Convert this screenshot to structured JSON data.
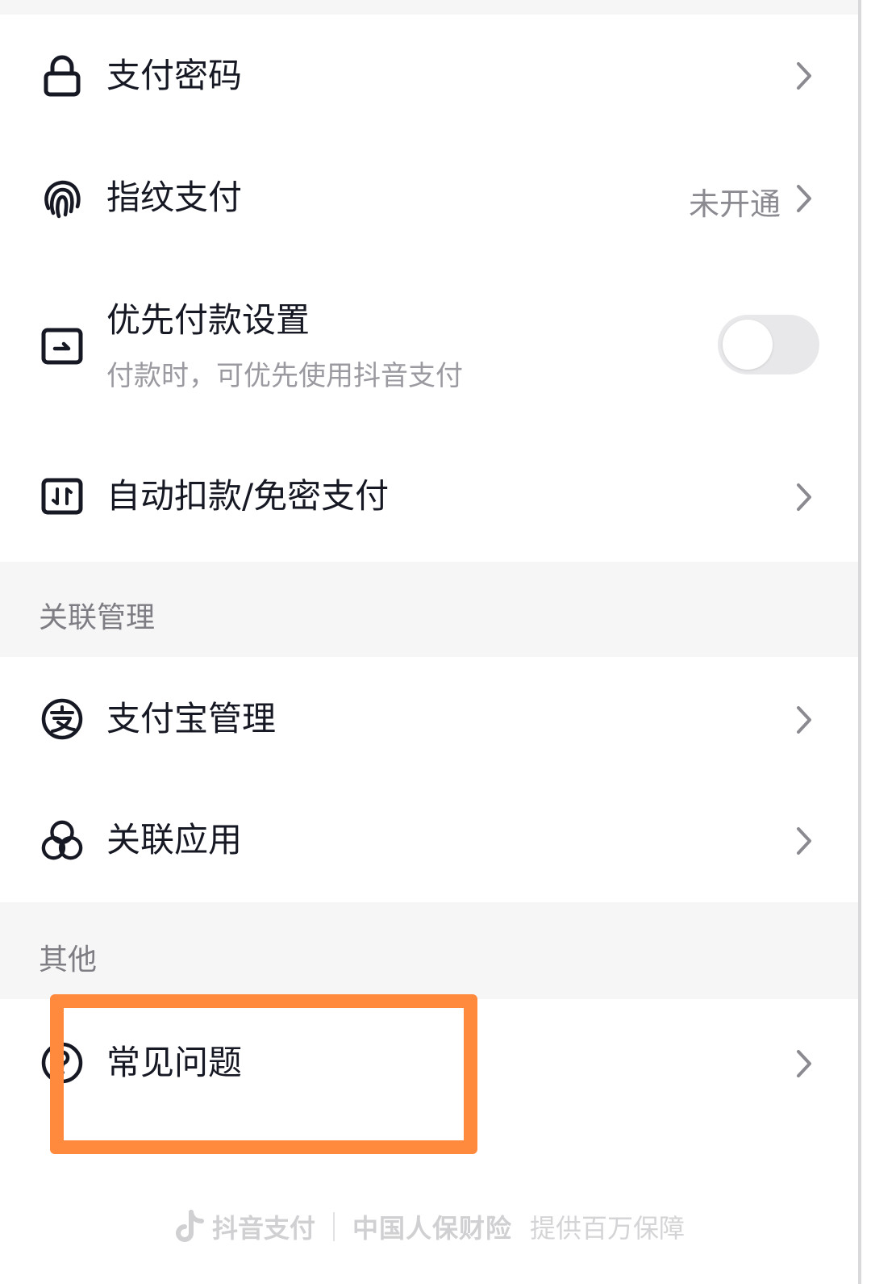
{
  "security_items": [
    {
      "label": "支付密码",
      "icon": "lock-icon"
    },
    {
      "label": "指纹支付",
      "icon": "fingerprint-icon",
      "value": "未开通"
    },
    {
      "label": "优先付款设置",
      "icon": "priority-payment-icon",
      "sub": "付款时，可优先使用抖音支付",
      "toggle": false
    },
    {
      "label": "自动扣款/免密支付",
      "icon": "auto-deduct-icon"
    }
  ],
  "linked_section": {
    "title": "关联管理",
    "items": [
      {
        "label": "支付宝管理",
        "icon": "alipay-icon"
      },
      {
        "label": "关联应用",
        "icon": "linked-apps-icon"
      }
    ]
  },
  "other_section": {
    "title": "其他",
    "items": [
      {
        "label": "常见问题",
        "icon": "question-icon"
      }
    ]
  },
  "footer": {
    "brand": "抖音支付",
    "insurer": "中国人保财险",
    "guarantee": "提供百万保障"
  },
  "colors": {
    "highlight": "#ff8a3d",
    "section_bg": "#f6f6f7",
    "text": "#161823"
  }
}
